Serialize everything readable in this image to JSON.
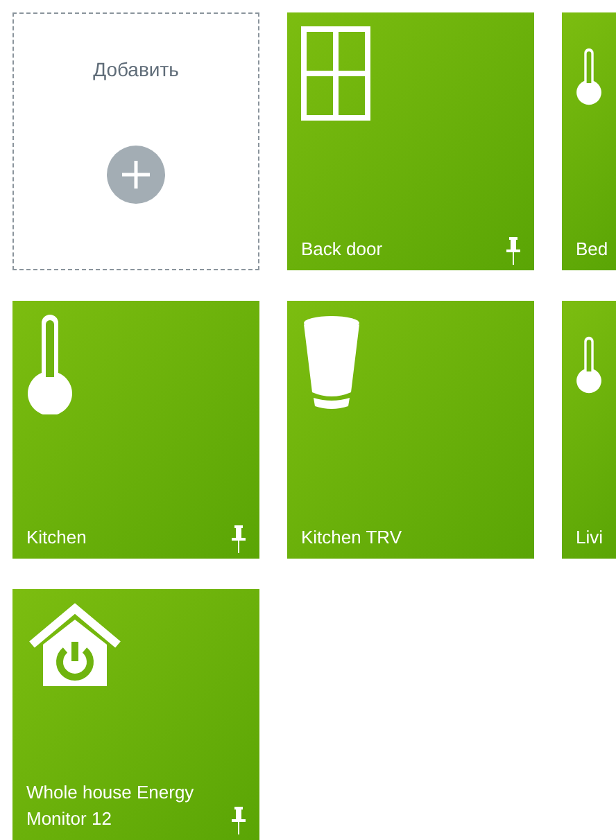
{
  "add_tile": {
    "label": "Добавить"
  },
  "tiles": [
    {
      "kind": "window",
      "label": "Back door",
      "pinned": true
    },
    {
      "kind": "thermometer",
      "label": "Bed"
    },
    {
      "kind": "thermometer",
      "label": "Kitchen",
      "pinned": true
    },
    {
      "kind": "trv",
      "label": "Kitchen TRV",
      "pinned": false
    },
    {
      "kind": "thermometer",
      "label": "Livi"
    },
    {
      "kind": "energy",
      "label": "Whole house Energy Monitor 12",
      "pinned": true
    }
  ]
}
